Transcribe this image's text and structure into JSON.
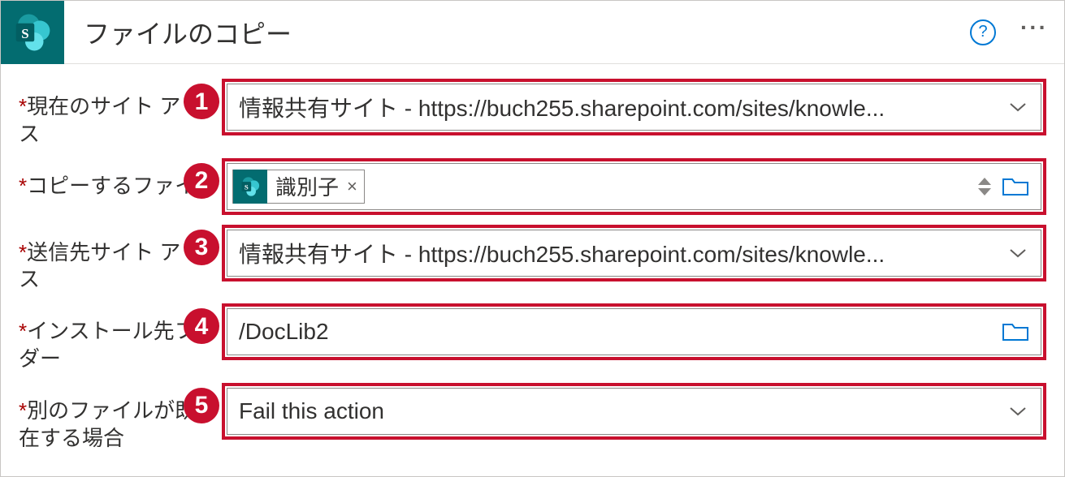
{
  "header": {
    "title": "ファイルのコピー"
  },
  "fields": {
    "currentSite": {
      "label": "現在のサイト アドレス",
      "labelTrunc": "現在のサイト ア\nス",
      "badge": "1",
      "value": "情報共有サイト - https://buch255.sharepoint.com/sites/knowle..."
    },
    "fileToCopy": {
      "label": "コピーするファイ",
      "badge": "2",
      "tokenLabel": "識別子"
    },
    "destSite": {
      "label": "送信先サイト アドレス",
      "labelTrunc": "送信先サイト ア\nス",
      "badge": "3",
      "value": "情報共有サイト - https://buch255.sharepoint.com/sites/knowle..."
    },
    "destFolder": {
      "label": "インストール先フォルダー",
      "labelTrunc": "インストール先フ\nダー",
      "badge": "4",
      "value": "/DocLib2"
    },
    "ifExists": {
      "label": "別のファイルが既に存在する場合",
      "labelTrunc": "別のファイルが既\n在する場合",
      "badge": "5",
      "value": "Fail this action"
    }
  }
}
